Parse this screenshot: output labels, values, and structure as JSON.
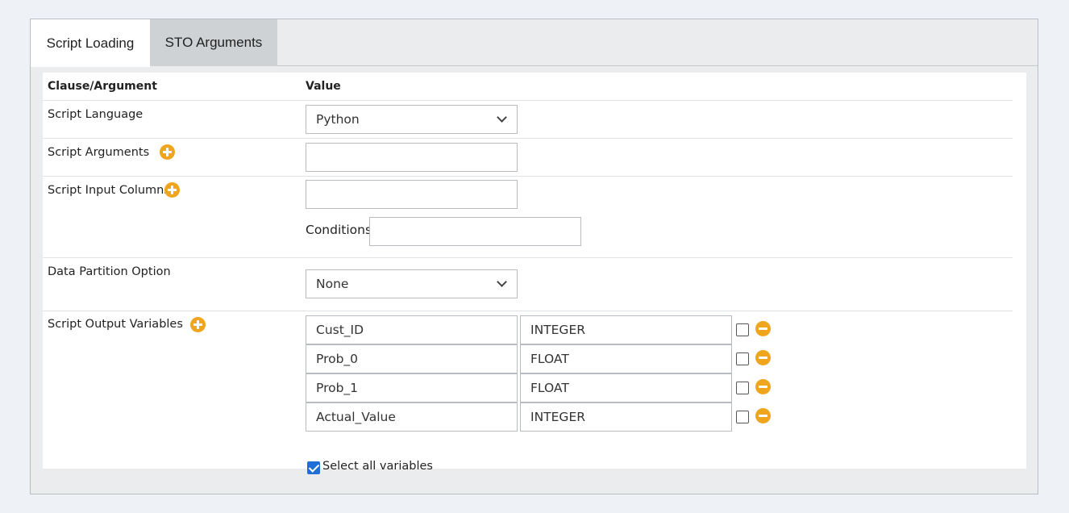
{
  "tabs": [
    {
      "label": "Script Loading"
    },
    {
      "label": "STO Arguments"
    }
  ],
  "table": {
    "col_clause": "Clause/Argument",
    "col_value": "Value"
  },
  "script_language": {
    "label": "Script Language",
    "value": "Python"
  },
  "script_arguments": {
    "label": "Script Arguments",
    "value": ""
  },
  "script_input_columns": {
    "label": "Script Input Columns",
    "value": ""
  },
  "conditions": {
    "label": "Conditions",
    "value": ""
  },
  "data_partition": {
    "label": "Data Partition Option",
    "value": "None"
  },
  "script_output": {
    "label": "Script Output Variables",
    "variables": [
      {
        "name": "Cust_ID",
        "type": "INTEGER",
        "checked": false
      },
      {
        "name": "Prob_0",
        "type": "FLOAT",
        "checked": false
      },
      {
        "name": "Prob_1",
        "type": "FLOAT",
        "checked": false
      },
      {
        "name": "Actual_Value",
        "type": "INTEGER",
        "checked": false
      }
    ],
    "select_all_label": "Select all variables",
    "select_all_checked": true
  },
  "colors": {
    "accent": "#f0a51e",
    "checkbox": "#1f6fd6"
  }
}
